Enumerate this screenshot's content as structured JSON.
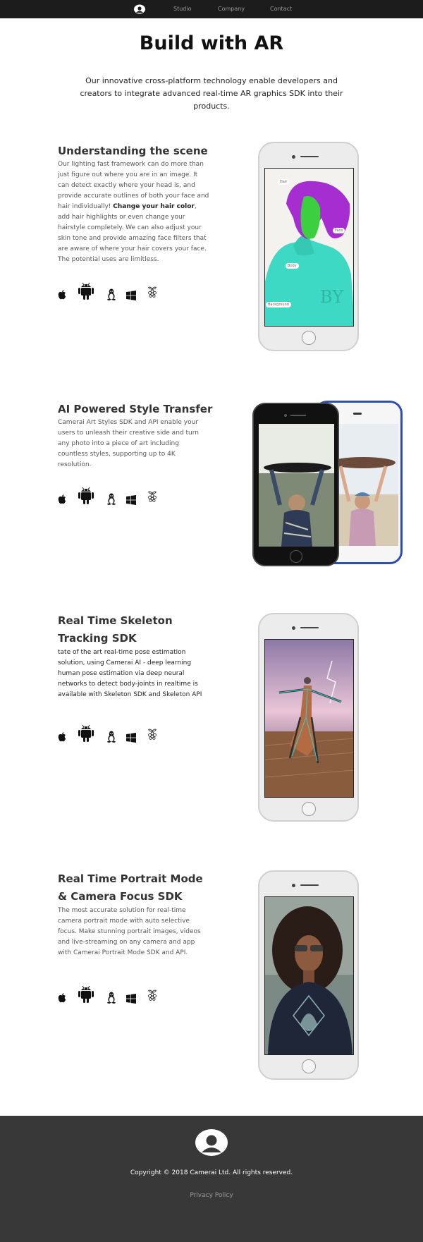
{
  "nav": {
    "links": [
      "Studio",
      "Company",
      "Contact"
    ]
  },
  "hero": {
    "title": "Build with AR",
    "subtitle": "Our innovative cross-platform technology enable developers and creators to integrate advanced real-time AR graphics SDK into their products."
  },
  "sections": [
    {
      "title": "Understanding the scene",
      "body_intro": "Our lighting fast framework can do more than just figure out where you are in an image. It can detect exactly where your head is, and provide accurate outlines of both your face and hair individually!",
      "body_bold": "Change your hair color",
      "body_rest": ", add hair highlights or even change your hairstyle completely. We can also adjust your skin tone and provide amazing face filters that are aware of where your hair covers your face. The potential uses are limitless.",
      "segmentation_labels": [
        "Hair",
        "Face",
        "Body",
        "Background"
      ]
    },
    {
      "title": "AI Powered Style Transfer",
      "body": "Camerai Art Styles SDK and API enable your users to unleash their creative side and turn any photo into a piece of art including countless styles, supporting up to 4K resolution."
    },
    {
      "title": "Real Time Skeleton Tracking SDK",
      "body": "tate of the art real-time pose estimation solution, using Camerai AI - deep learning human pose estimation via deep neural networks to detect body-joints in realtime is available with Skeleton SDK and Skeleton API"
    },
    {
      "title": "Real Time Portrait Mode & Camera Focus SDK",
      "body": "The most accurate solution for real-time camera portrait mode with auto selective focus. Make stunning portrait images, videos and live-streaming on any camera and app with Camerai Portrait Mode SDK and API."
    }
  ],
  "platform_icons": [
    "apple-icon",
    "android-icon",
    "linux-icon",
    "windows-icon",
    "raspberry-pi-icon"
  ],
  "footer": {
    "copyright": "Copyright © 2018 Camerai Ltd. All rights reserved.",
    "privacy": "Privacy Policy"
  },
  "colors": {
    "topbar": "#1c1c1c",
    "footer": "#383838",
    "accent_blue": "#2d4fb7"
  }
}
